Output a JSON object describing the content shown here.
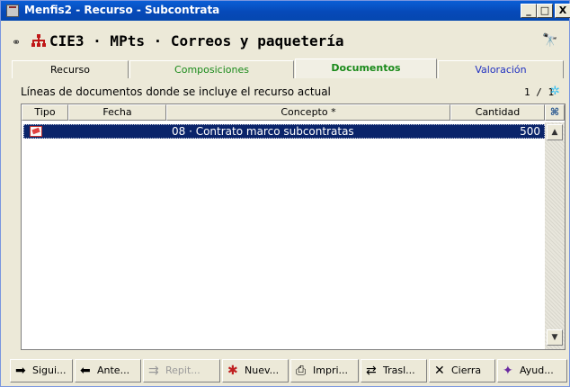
{
  "window": {
    "title": "Menfis2 - Recurso - Subcontrata",
    "min_label": "_",
    "max_label": "□",
    "close_label": "X"
  },
  "header": {
    "link_symbol": "⚭",
    "path": "CIE3 · MPts · Correos y paquetería",
    "binoculars_symbol": "🔭"
  },
  "tabs": [
    {
      "label": "Recurso"
    },
    {
      "label": "Composiciones"
    },
    {
      "label": "Documentos",
      "selected": true
    },
    {
      "label": "Valoración"
    }
  ],
  "subheader": {
    "description": "Líneas de documentos donde se incluye el recurso actual",
    "pager": "1 / 1",
    "refresh_symbol": "✲"
  },
  "grid": {
    "columns": [
      "Tipo",
      "Fecha",
      "Concepto *",
      "Cantidad"
    ],
    "column_icon": "⌘",
    "rows": [
      {
        "tipo_icon": "document-icon",
        "fecha": "",
        "concepto": "08 · Contrato marco subcontratas",
        "cantidad": "500"
      }
    ],
    "scroll_up": "▲",
    "scroll_down": "▼"
  },
  "toolbar": {
    "buttons": [
      {
        "label": "Sigui...",
        "icon": "➡",
        "color": "#000000"
      },
      {
        "label": "Ante...",
        "icon": "⬅",
        "color": "#000000"
      },
      {
        "label": "Repit...",
        "icon": "⇉",
        "disabled": true
      },
      {
        "label": "Nuev...",
        "icon": "✱",
        "color": "#c02020"
      },
      {
        "label": "Impri...",
        "icon": "⎙",
        "color": "#000000"
      },
      {
        "label": "Trasl...",
        "icon": "⇄",
        "color": "#000000"
      },
      {
        "label": "Cierra",
        "icon": "✕",
        "color": "#000000"
      },
      {
        "label": "Ayud...",
        "icon": "✦",
        "color": "#6a2aa0"
      }
    ]
  },
  "colors": {
    "selection": "#0a246a",
    "green_tab": "#1a8a1a",
    "blue_tab": "#2030c0"
  }
}
